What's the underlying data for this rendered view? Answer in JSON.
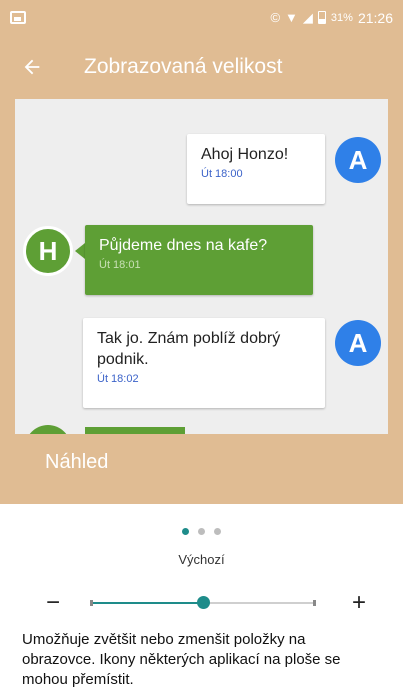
{
  "status_bar": {
    "battery": "31%",
    "time": "21:26",
    "icons": [
      "image-icon",
      "data-saver-icon",
      "wifi-icon",
      "signal-icon",
      "battery-icon"
    ]
  },
  "app_bar": {
    "title": "Zobrazovaná velikost",
    "back_icon": "back-arrow-icon"
  },
  "preview": {
    "messages": [
      {
        "text": "Ahoj Honzo!",
        "time": "Út 18:00",
        "avatar": "A"
      },
      {
        "text": "Půjdeme dnes na kafe?",
        "time": "Út 18:01",
        "avatar": "H"
      },
      {
        "text": "Tak jo. Znám poblíž dobrý podnik.",
        "time": "Út 18:02",
        "avatar": "A"
      }
    ],
    "label": "Náhled"
  },
  "size": {
    "current_label": "Výchozí",
    "level": 2,
    "levels": 5,
    "minus": "−",
    "plus": "+"
  },
  "description": "Umožňuje zvětšit nebo zmenšit položky na obrazovce. Ikony některých aplikací na ploše se mohou přemístit.",
  "colors": {
    "accent": "#e0bc93",
    "teal": "#1e8c8a",
    "green": "#5e9f35",
    "blue": "#2f80e8"
  }
}
